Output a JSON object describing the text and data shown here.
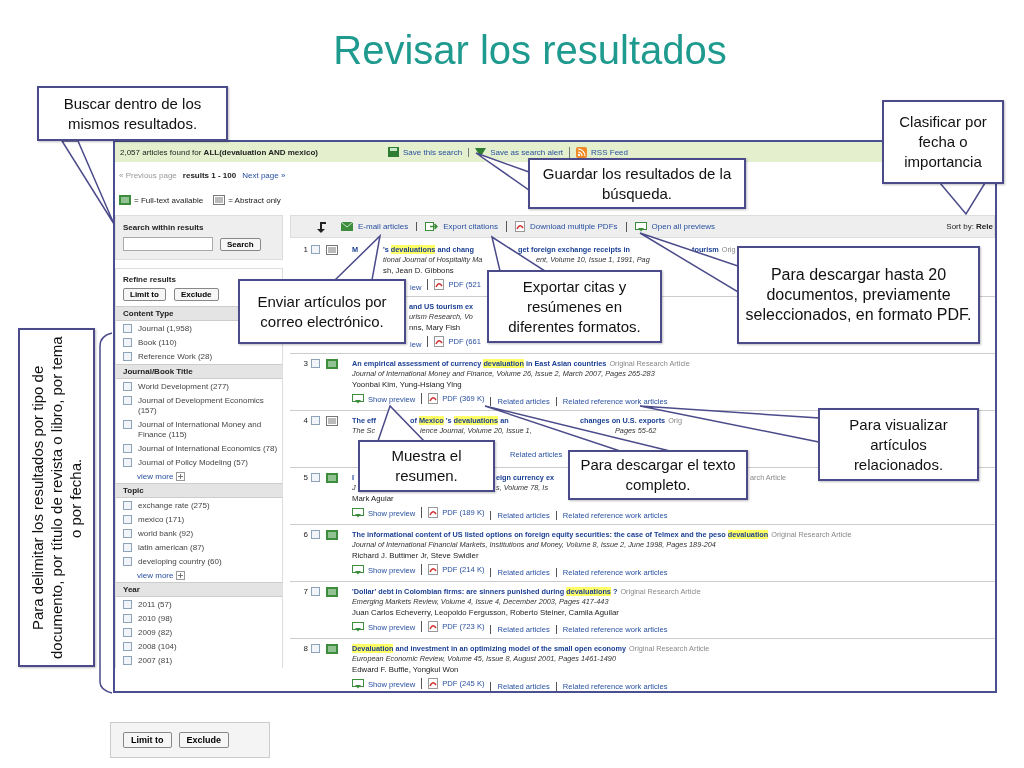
{
  "slide_title": "Revisar los resultados",
  "screenshot": {
    "summary": "2,057 articles found for **ALL(devaluation AND mexico)**",
    "header_links": [
      {
        "kind": "save",
        "label": "Save this search"
      },
      {
        "kind": "alert",
        "label": "Save as search alert"
      },
      {
        "kind": "rss",
        "label": "RSS Feed"
      }
    ],
    "pager": {
      "previous": "« Previous page",
      "range": "results 1 - 100",
      "next": "Next page »"
    },
    "legend": [
      {
        "kind": "full",
        "label": "= Full-text available"
      },
      {
        "kind": "abstract",
        "label": "= Abstract only"
      }
    ],
    "sidebar": {
      "search_title": "Search within results",
      "search_button": "Search",
      "refine_title": "Refine results",
      "refine_buttons": [
        "Limit to",
        "Exclude"
      ],
      "sections": [
        {
          "title": "Content Type",
          "items": [
            {
              "label": "Journal (1,958)",
              "checked": false
            },
            {
              "label": "Book (110)",
              "checked": false
            },
            {
              "label": "Reference Work (28)",
              "checked": false
            }
          ]
        },
        {
          "title": "Journal/Book Title",
          "items": [
            {
              "label": "World Development (277)",
              "checked": false
            },
            {
              "label": "Journal of Development Economics (157)",
              "checked": false
            },
            {
              "label": "Journal of International Money and Finance (115)",
              "checked": false
            },
            {
              "label": "Journal of International Economics (78)",
              "checked": false
            },
            {
              "label": "Journal of Policy Modeling (57)",
              "checked": false
            }
          ],
          "more": "view more"
        },
        {
          "title": "Topic",
          "items": [
            {
              "label": "exchange rate (275)",
              "checked": false
            },
            {
              "label": "mexico (171)",
              "checked": false
            },
            {
              "label": "world bank (92)",
              "checked": false
            },
            {
              "label": "latin american (87)",
              "checked": false
            },
            {
              "label": "developing country (60)",
              "checked": false
            }
          ],
          "more": "view more"
        },
        {
          "title": "Year",
          "items": [
            {
              "label": "2011 (57)",
              "checked": false
            },
            {
              "label": "2010 (98)",
              "checked": false
            },
            {
              "label": "2009 (82)",
              "checked": false
            },
            {
              "label": "2008 (104)",
              "checked": false
            },
            {
              "label": "2007 (81)",
              "checked": false
            }
          ]
        }
      ]
    },
    "toolbar": {
      "actions": [
        {
          "kind": "mail",
          "label": "E-mail articles"
        },
        {
          "kind": "export",
          "label": "Export citations"
        },
        {
          "kind": "pdf",
          "label": "Download multiple PDFs"
        },
        {
          "kind": "preview",
          "label": "Open all previews"
        }
      ],
      "sort": "Sort by: **Rele**"
    },
    "results": [
      {
        "number": "1",
        "checked": false,
        "kind": "abstract",
        "title": [
          [
            {
              "kind": "title",
              "text": "M"
            }
          ],
          [
            {
              "kind": "title",
              "text": "'s "
            },
            {
              "kind": "highlight",
              "text": "devaluations"
            },
            {
              "kind": "title",
              "text": " and chang"
            }
          ],
          [
            {
              "kind": "title",
              "text": "get foreign exchange receipts in"
            }
          ],
          [
            {
              "kind": "title",
              "text": "tourism"
            },
            {
              "kind": "type",
              "text": "Orig"
            }
          ]
        ],
        "source": [
          "tional Journal of Hospitality Ma",
          "ent, Volume 10, Issue 1, 1991, Pag"
        ],
        "authors": [
          "sh, Jean D. Gibbons"
        ],
        "links": [
          [
            {
              "kind": "link",
              "text": "iew"
            },
            {
              "kind": "pdf",
              "text": "PDF (521"
            }
          ]
        ]
      },
      {
        "title": [
          [
            {
              "kind": "title",
              "text": "and US tourism ex"
            }
          ]
        ],
        "source": [
          "urism Research, Vo"
        ],
        "authors": [
          "nns, Mary Fish"
        ],
        "links": [
          [
            {
              "kind": "link",
              "text": "iew"
            },
            {
              "kind": "pdf",
              "text": "PDF (661"
            }
          ]
        ]
      },
      {
        "number": "3",
        "checked": false,
        "kind": "full",
        "title": [
          [
            {
              "kind": "title",
              "text": "An empirical assessment of currency "
            },
            {
              "kind": "highlight",
              "text": "devaluation"
            },
            {
              "kind": "title",
              "text": " in East Asian countries"
            },
            {
              "kind": "type",
              "text": "Original Research Article"
            }
          ]
        ],
        "source": [
          "Journal of International Money and Finance, Volume 26, Issue 2, March 2007, Pages 265-283"
        ],
        "authors": [
          "Yoonbai Kim, Yung-Hsiang Ying"
        ],
        "links": [
          [
            {
              "kind": "preview",
              "text": "Show preview"
            },
            {
              "kind": "pdf",
              "text": "PDF (369 K)"
            },
            {
              "kind": "link",
              "text": "Related articles"
            },
            {
              "kind": "link",
              "text": "Related reference work articles"
            }
          ]
        ]
      },
      {
        "number": "4",
        "checked": false,
        "kind": "abstract",
        "title": [
          [
            {
              "kind": "title",
              "text": "The eff"
            }
          ],
          [
            {
              "kind": "title",
              "text": "of "
            },
            {
              "kind": "highlight",
              "text": "Mexico"
            },
            {
              "kind": "title",
              "text": " 's "
            },
            {
              "kind": "highlight",
              "text": "devaluations"
            },
            {
              "kind": "title",
              "text": " an"
            }
          ],
          [
            {
              "kind": "title",
              "text": "changes on U.S. exports"
            },
            {
              "kind": "type",
              "text": "Orig"
            }
          ]
        ],
        "source": [
          "The Sc",
          "ience Journal, Volume 20, Issue 1,",
          "Pages 55-62"
        ],
        "links": [
          [
            {
              "kind": "link",
              "text": "Related articles"
            }
          ]
        ]
      },
      {
        "number": "5",
        "checked": false,
        "kind": "full",
        "title": [
          [
            {
              "kind": "title",
              "text": "I"
            }
          ],
          [
            {
              "kind": "title",
              "text": "eign currency ex"
            }
          ],
          [
            {
              "kind": "type",
              "text": "arch Article"
            }
          ]
        ],
        "source": [
          "J",
          "s, Volume 78, Is"
        ],
        "authors": [
          "Mark Aguiar"
        ],
        "links": [
          [
            {
              "kind": "preview",
              "text": "Show preview"
            },
            {
              "kind": "pdf",
              "text": "PDF (189 K)"
            },
            {
              "kind": "link",
              "text": "Related articles"
            },
            {
              "kind": "link",
              "text": "Related reference work articles"
            }
          ]
        ]
      },
      {
        "number": "6",
        "checked": false,
        "kind": "full",
        "title": [
          [
            {
              "kind": "title",
              "text": "The informational content of US listed options on foreign equity securities: the case of Telmex and the peso "
            },
            {
              "kind": "highlight",
              "text": "devaluation"
            },
            {
              "kind": "type",
              "text": "Original Research Article"
            }
          ]
        ],
        "source": [
          "Journal of International Financial Markets, Institutions and Money, Volume 8, Issue 2, June 1998, Pages 189-204"
        ],
        "authors": [
          "Richard J. Buttimer Jr, Steve Swidler"
        ],
        "links": [
          [
            {
              "kind": "preview",
              "text": "Show preview"
            },
            {
              "kind": "pdf",
              "text": "PDF (214 K)"
            },
            {
              "kind": "link",
              "text": "Related articles"
            },
            {
              "kind": "link",
              "text": "Related reference work articles"
            }
          ]
        ]
      },
      {
        "number": "7",
        "checked": false,
        "kind": "full",
        "title": [
          [
            {
              "kind": "title",
              "text": "'Dollar' debt in Colombian firms: are sinners punished during "
            },
            {
              "kind": "highlight",
              "text": "devaluations"
            },
            {
              "kind": "title",
              "text": " ?"
            },
            {
              "kind": "type",
              "text": "Original Research Article"
            }
          ]
        ],
        "source": [
          "Emerging Markets Review, Volume 4, Issue 4, December 2003, Pages 417-443"
        ],
        "authors": [
          "Juan Carlos Echeverry, Leopoldo Fergusson, Roberto Steiner, Camila Aguilar"
        ],
        "links": [
          [
            {
              "kind": "preview",
              "text": "Show preview"
            },
            {
              "kind": "pdf",
              "text": "PDF (723 K)"
            },
            {
              "kind": "link",
              "text": "Related articles"
            },
            {
              "kind": "link",
              "text": "Related reference work articles"
            }
          ]
        ]
      },
      {
        "number": "8",
        "checked": false,
        "kind": "full",
        "title": [
          [
            {
              "kind": "highlight",
              "text": "Devaluation"
            },
            {
              "kind": "title",
              "text": " and investment in an optimizing model of the small open economy"
            },
            {
              "kind": "type",
              "text": "Original Research Article"
            }
          ]
        ],
        "source": [
          "European Economic Review, Volume 45, Issue 8, August 2001, Pages 1461-1490"
        ],
        "authors": [
          "Edward F. Buffie, Yongkul Won"
        ],
        "links": [
          [
            {
              "kind": "preview",
              "text": "Show preview"
            },
            {
              "kind": "pdf",
              "text": "PDF (245 K)"
            },
            {
              "kind": "link",
              "text": "Related articles"
            },
            {
              "kind": "link",
              "text": "Related reference work articles"
            }
          ]
        ]
      }
    ]
  },
  "callouts": [
    "Buscar dentro de los mismos resultados.",
    "Guardar los resultados de la búsqueda.",
    "Clasificar por fecha o importancia",
    "Enviar artículos por correo electrónico.",
    "Exportar citas y resúmenes en diferentes formatos.",
    "Para descargar hasta 20 documentos, previamente seleccionados, en formato PDF.",
    "Muestra el resumen.",
    "Para descargar el texto completo.",
    "Para visualizar artículos relacionados."
  ],
  "side_note": "Para delimitar los resultados por tipo de documento, por título de revista o libro, por tema o por fecha.",
  "snippet_buttons": [
    "Limit to",
    "Exclude"
  ]
}
